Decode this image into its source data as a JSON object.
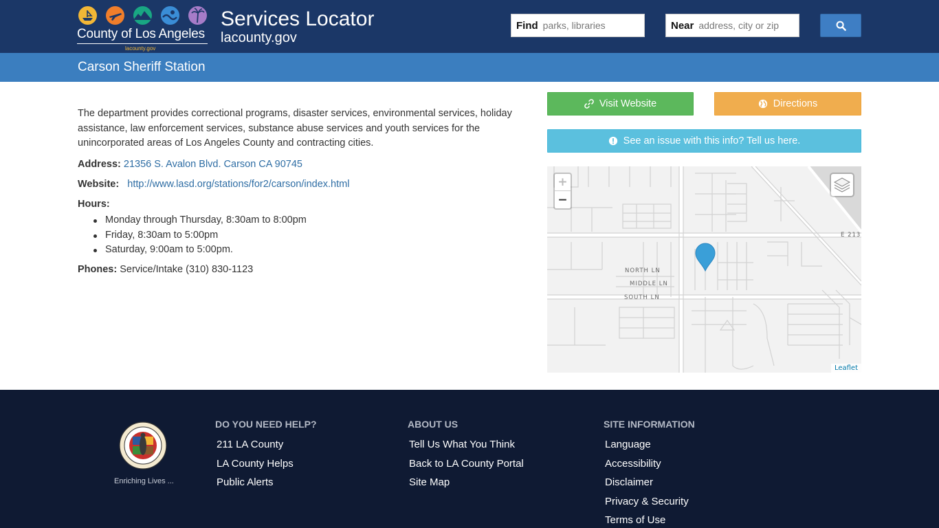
{
  "header": {
    "logo_text": "County of Los Angeles",
    "logo_sub": "lacounty.gov",
    "title": "Services Locator",
    "subtitle": "lacounty.gov",
    "find_label": "Find",
    "find_placeholder": "parks, libraries",
    "near_label": "Near",
    "near_placeholder": "address, city or zip",
    "search_icon": "search-icon"
  },
  "page": {
    "title": "Carson Sheriff Station"
  },
  "details": {
    "description": "The department provides correctional programs, disaster services, environmental services, holiday assistance, law enforcement services, substance abuse services and youth services for the unincorporated areas of Los Angeles County and contracting cities.",
    "address_label": "Address:",
    "address_value": "21356 S. Avalon Blvd. Carson CA 90745",
    "website_label": "Website:",
    "website_value": "http://www.lasd.org/stations/for2/carson/index.html",
    "hours_label": "Hours:",
    "hours": [
      "Monday through Thursday, 8:30am to 8:00pm",
      "Friday, 8:30am to 5:00pm",
      "Saturday, 9:00am to 5:00pm."
    ],
    "phones_label": "Phones:",
    "phones_value": "Service/Intake (310) 830-1123"
  },
  "actions": {
    "visit_label": "Visit Website",
    "directions_label": "Directions",
    "issue_label": "See an issue with this info? Tell us here.",
    "colors": {
      "visit": "#5cb85c",
      "directions": "#f0ad4e",
      "issue": "#5bc0de"
    }
  },
  "map": {
    "zoom_in": "+",
    "zoom_out": "−",
    "attribution": "Leaflet",
    "street_labels": [
      "NORTH LN",
      "MIDDLE LN",
      "SOUTH LN",
      "E 213"
    ],
    "marker_color": "#3a9fd8"
  },
  "footer": {
    "tagline": "Enriching Lives ...",
    "help_heading": "DO YOU NEED HELP?",
    "help_links": [
      "211 LA County",
      "LA County Helps",
      "Public Alerts"
    ],
    "about_heading": "ABOUT US",
    "about_links": [
      "Tell Us What You Think",
      "Back to LA County Portal",
      "Site Map"
    ],
    "site_heading": "SITE INFORMATION",
    "site_links": [
      "Language",
      "Accessibility",
      "Disclaimer",
      "Privacy & Security",
      "Terms of Use"
    ]
  },
  "colors": {
    "header_bg": "#1b3767",
    "subbar_bg": "#3b7ebf",
    "footer_bg": "#0f1a33",
    "link": "#2e6da4"
  }
}
